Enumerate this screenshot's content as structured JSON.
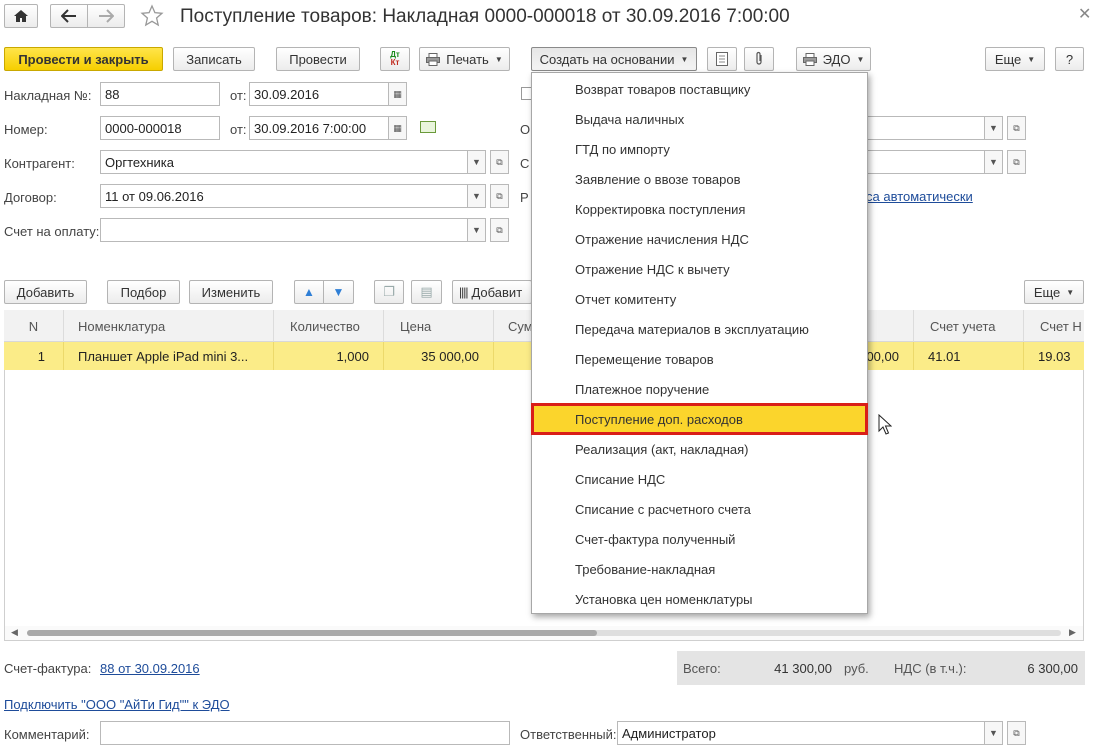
{
  "window": {
    "title": "Поступление товаров: Накладная 0000-000018 от 30.09.2016 7:00:00"
  },
  "toolbar": {
    "post_close": "Провести и закрыть",
    "save": "Записать",
    "post": "Провести",
    "print": "Печать",
    "create_based": "Создать на основании",
    "edo": "ЭДО",
    "more": "Еще",
    "help": "?",
    "dtkt_icon": "Дт Кт"
  },
  "header": {
    "invoice_no_label": "Накладная №:",
    "invoice_no": "88",
    "from_label": "от:",
    "invoice_date": "30.09.2016",
    "number_label": "Номер:",
    "number": "0000-000018",
    "number_date": "30.09.2016  7:00:00",
    "counterparty_label": "Контрагент:",
    "counterparty": "Оргтехника",
    "contract_label": "Договор:",
    "contract": "11 от 09.06.2016",
    "payment_account_label": "Счет на оплату:",
    "payment_account": "",
    "right_label_o": "О",
    "right_label_s": "С",
    "right_label_r": "Р",
    "settlements_link": "са автоматически"
  },
  "table_toolbar": {
    "add": "Добавить",
    "select": "Подбор",
    "change": "Изменить",
    "add_barcode": "Добавит",
    "more": "Еще"
  },
  "table": {
    "columns": [
      "N",
      "Номенклатура",
      "Количество",
      "Цена",
      "Сум",
      "Счет учета",
      "Счет Н"
    ],
    "rows": [
      {
        "n": "1",
        "item": "Планшет Apple iPad mini 3...",
        "qty": "1,000",
        "price": "35 000,00",
        "sum_tail": "00,00",
        "account": "41.01",
        "vat_account": "19.03"
      }
    ]
  },
  "menu": {
    "items": [
      "Возврат товаров поставщику",
      "Выдача наличных",
      "ГТД по импорту",
      "Заявление о ввозе товаров",
      "Корректировка поступления",
      "Отражение начисления НДС",
      "Отражение НДС к вычету",
      "Отчет комитенту",
      "Передача материалов в эксплуатацию",
      "Перемещение товаров",
      "Платежное поручение",
      "Поступление доп. расходов",
      "Реализация (акт, накладная)",
      "Списание НДС",
      "Списание с расчетного счета",
      "Счет-фактура полученный",
      "Требование-накладная",
      "Установка цен номенклатуры"
    ],
    "highlighted_index": 11
  },
  "footer": {
    "invoice_label": "Счет-фактура:",
    "invoice_link": "88 от 30.09.2016",
    "total_label": "Всего:",
    "total": "41 300,00",
    "currency": "руб.",
    "vat_label": "НДС (в т.ч.):",
    "vat": "6 300,00",
    "edo_link": "Подключить \"ООО \"АйТи Гид\"\" к ЭДО",
    "comment_label": "Комментарий:",
    "comment": "",
    "responsible_label": "Ответственный:",
    "responsible": "Администратор"
  },
  "colors": {
    "accent_yellow": "#f6cf00",
    "row_highlight": "#fbec88",
    "menu_highlight": "#fbd52c",
    "highlight_border": "#d91e18",
    "link": "#1e4c9a"
  }
}
